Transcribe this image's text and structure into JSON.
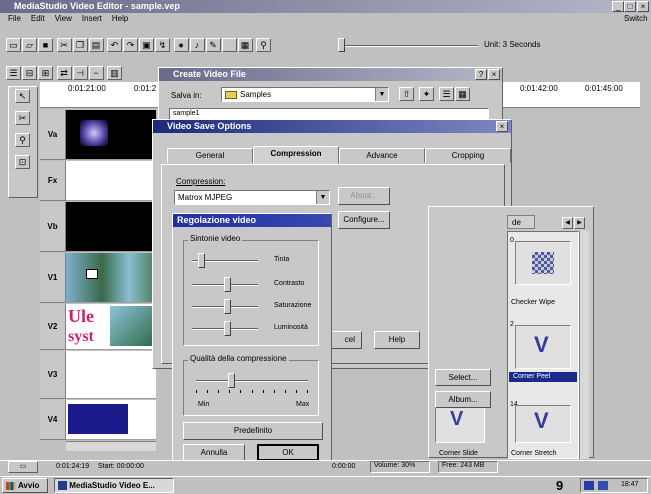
{
  "window": {
    "title": "MediaStudio Video Editor - sample.vep"
  },
  "menu": {
    "items": [
      "File",
      "Edit",
      "View",
      "Insert",
      "Help"
    ],
    "switch_label": "Switch"
  },
  "toolbar": {
    "unit_label": "Unit: 3 Seconds"
  },
  "timecodes": [
    "0:01:21:00",
    "0:01:2",
    "0:01:42:00",
    "0:01:45:00"
  ],
  "tracks": [
    {
      "label": "Va"
    },
    {
      "label": "Fx"
    },
    {
      "label": "Vb"
    },
    {
      "label": "V1"
    },
    {
      "label": "V2"
    },
    {
      "label": "V3"
    },
    {
      "label": "V4"
    }
  ],
  "title_clip": {
    "line1": "Ule",
    "line2": "syst"
  },
  "create_video": {
    "title": "Create Video File",
    "save_in_label": "Salva in:",
    "folder_value": "Samples",
    "file_row": "sample1"
  },
  "save_options": {
    "title": "Video Save Options",
    "tabs": [
      "General",
      "Compression",
      "Advance",
      "Cropping"
    ],
    "compression_label": "Compression:",
    "compression_value": "Matrox MJPEG",
    "about_label": "About...",
    "configure_label": "Configure...",
    "cancel_partial": "cel",
    "help_label": "Help"
  },
  "video_adjust": {
    "title": "Regolazione video",
    "tuning_group": "Sintonie video",
    "sliders": [
      {
        "label": "Tinta",
        "level": 0.1
      },
      {
        "label": "Contrasto",
        "level": 0.5
      },
      {
        "label": "Saturazione",
        "level": 0.5
      },
      {
        "label": "Luminosità",
        "level": 0.5
      }
    ],
    "quality_group": "Qualità della compressione",
    "quality_level": 0.3,
    "min_label": "Min",
    "max_label": "Max",
    "default_label": "Predefinito",
    "cancel_label": "Annulla",
    "ok_label": "OK"
  },
  "library": {
    "partial_tab": "de",
    "select_label": "Select...",
    "album_label": "Album...",
    "thumbs": [
      {
        "label": "Checker Wipe",
        "num": "0"
      },
      {
        "label": "Corner Peel",
        "num": "2"
      },
      {
        "label": "Corner Stretch",
        "num": "14"
      },
      {
        "label": "Corner Slide",
        "num": ""
      }
    ]
  },
  "status": {
    "timecode": "0:01:24:19",
    "start": "Start: 00:00:00",
    "mid": "0:00:00",
    "volume": "Volume: 30%",
    "free": "Free: 243 MB"
  },
  "taskbar": {
    "start_label": "Avvio",
    "task_label": "MediaStudio Video E...",
    "page_number": "9",
    "clock": "18:47"
  }
}
